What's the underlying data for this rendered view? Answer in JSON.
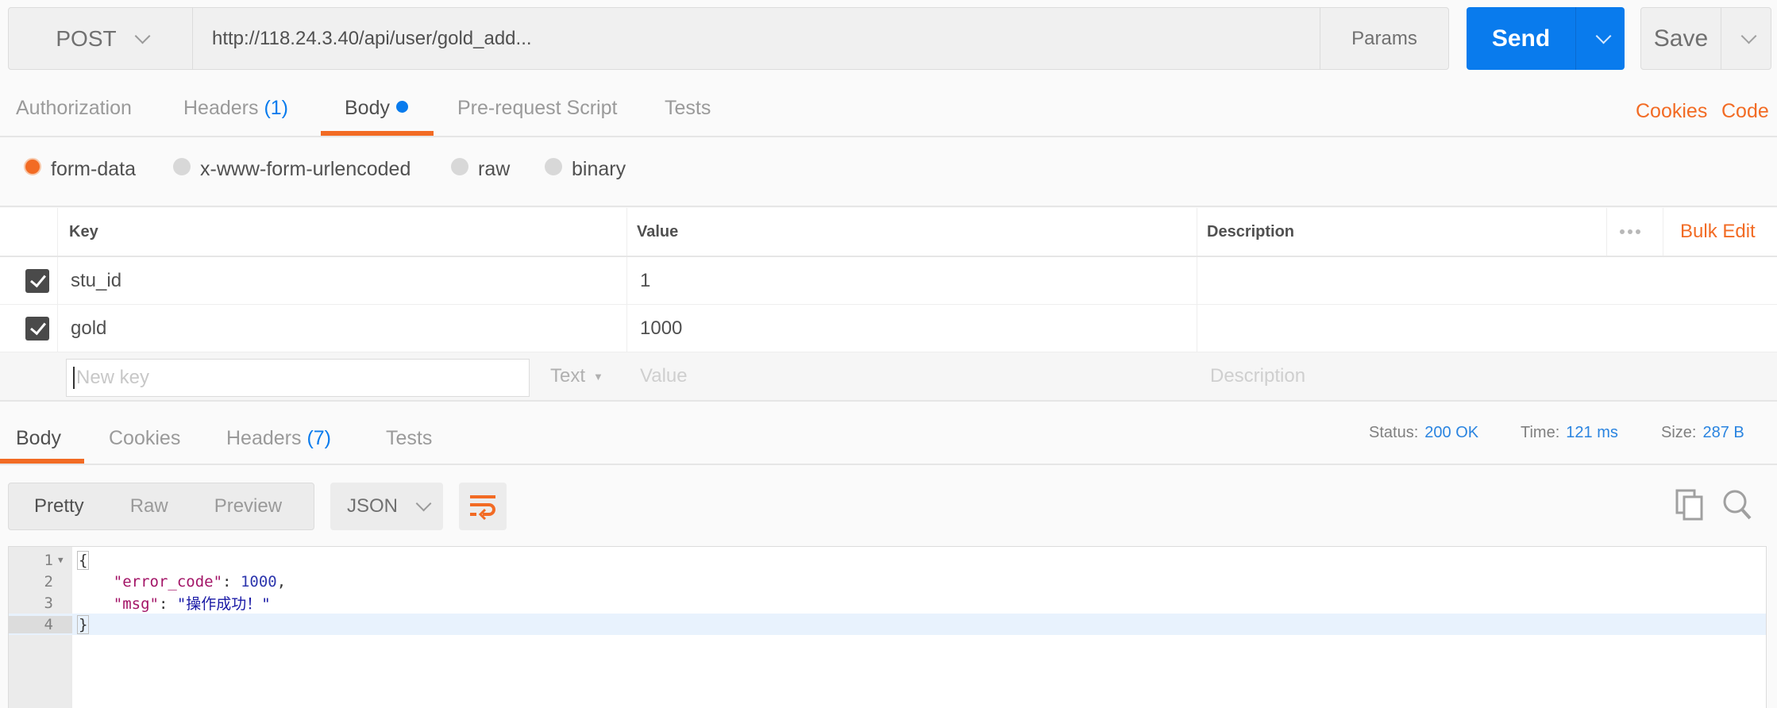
{
  "request": {
    "method": "POST",
    "url": "http://118.24.3.40/api/user/gold_add...",
    "params_label": "Params",
    "send_label": "Send",
    "save_label": "Save"
  },
  "request_tabs": [
    {
      "label": "Authorization",
      "count": null,
      "active": false
    },
    {
      "label": "Headers",
      "count": "(1)",
      "active": false
    },
    {
      "label": "Body",
      "count": null,
      "active": true,
      "dot": true
    },
    {
      "label": "Pre-request Script",
      "count": null,
      "active": false
    },
    {
      "label": "Tests",
      "count": null,
      "active": false
    }
  ],
  "request_links": {
    "cookies": "Cookies",
    "code": "Code"
  },
  "body_types": [
    {
      "label": "form-data",
      "selected": true
    },
    {
      "label": "x-www-form-urlencoded",
      "selected": false
    },
    {
      "label": "raw",
      "selected": false
    },
    {
      "label": "binary",
      "selected": false
    }
  ],
  "form_table": {
    "columns": [
      "Key",
      "Value",
      "Description"
    ],
    "bulk_edit": "Bulk Edit",
    "rows": [
      {
        "checked": true,
        "key": "stu_id",
        "value": "1",
        "description": ""
      },
      {
        "checked": true,
        "key": "gold",
        "value": "1000",
        "description": ""
      }
    ],
    "new_row": {
      "key_placeholder": "New key",
      "type": "Text",
      "value_placeholder": "Value",
      "description_placeholder": "Description"
    }
  },
  "response_tabs": [
    {
      "label": "Body",
      "count": null,
      "active": true
    },
    {
      "label": "Cookies",
      "count": null,
      "active": false
    },
    {
      "label": "Headers",
      "count": "(7)",
      "active": false
    },
    {
      "label": "Tests",
      "count": null,
      "active": false
    }
  ],
  "response_meta": {
    "status_label": "Status:",
    "status": "200 OK",
    "time_label": "Time:",
    "time": "121 ms",
    "size_label": "Size:",
    "size": "287 B"
  },
  "view_modes": [
    "Pretty",
    "Raw",
    "Preview"
  ],
  "active_view_mode": "Pretty",
  "format": "JSON",
  "icons": {
    "wrap": "word-wrap-icon",
    "copy": "copy-icon",
    "search": "search-icon"
  },
  "colors": {
    "accent": "#f26b24",
    "primary": "#097bed"
  },
  "response_body": {
    "line_numbers": [
      "1",
      "2",
      "3",
      "4"
    ],
    "open_brace": "{",
    "close_brace": "}",
    "key1": "\"error_code\"",
    "val1": "1000",
    "key2": "\"msg\"",
    "val2": "\"操作成功！\""
  }
}
